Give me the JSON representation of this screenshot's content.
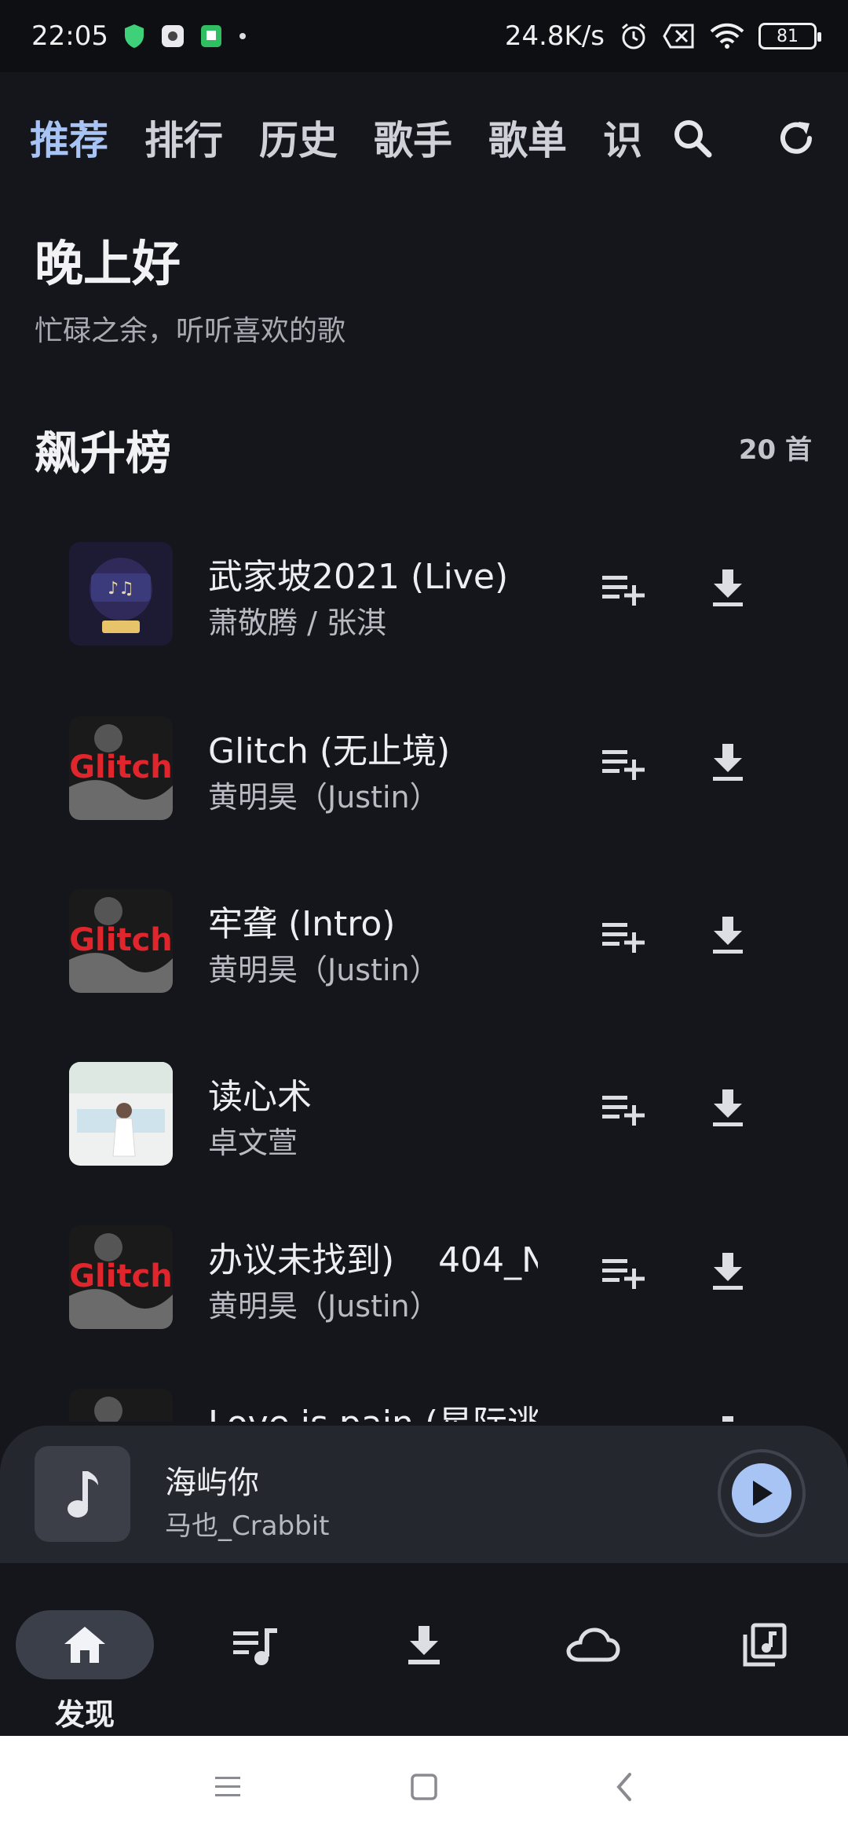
{
  "status_bar": {
    "time": "22:05",
    "net_speed": "24.8K/s",
    "battery": "81"
  },
  "top_tabs": [
    "推荐",
    "排行",
    "历史",
    "歌手",
    "歌单",
    "识"
  ],
  "greeting": {
    "title": "晚上好",
    "subtitle": "忙碌之余，听听喜欢的歌"
  },
  "section": {
    "title": "飙升榜",
    "count": "20 首"
  },
  "songs": [
    {
      "title": "武家坡2021 (Live)",
      "artist": "萧敬腾 / 张淇",
      "cover": "dark-stage"
    },
    {
      "title": "Glitch (无止境)",
      "artist": "黄明昊（Justin）",
      "cover": "glitch"
    },
    {
      "title": "牢聋 (Intro)",
      "artist": "黄明昊（Justin）",
      "cover": "glitch"
    },
    {
      "title": "读心术",
      "artist": "卓文萱",
      "cover": "light"
    },
    {
      "title": "办议未找到)    404_N",
      "artist": "黄明昊（Justin）",
      "cover": "glitch"
    },
    {
      "title": "Love is pain (星际逃",
      "artist": "",
      "cover": "glitch"
    }
  ],
  "mini_player": {
    "title": "海屿你",
    "artist": "马也_Crabbit"
  },
  "bottom_nav": {
    "discover_label": "发现"
  },
  "colors": {
    "accent": "#a7c4f5",
    "background": "#15161b",
    "glitch_red": "#e0262c"
  }
}
